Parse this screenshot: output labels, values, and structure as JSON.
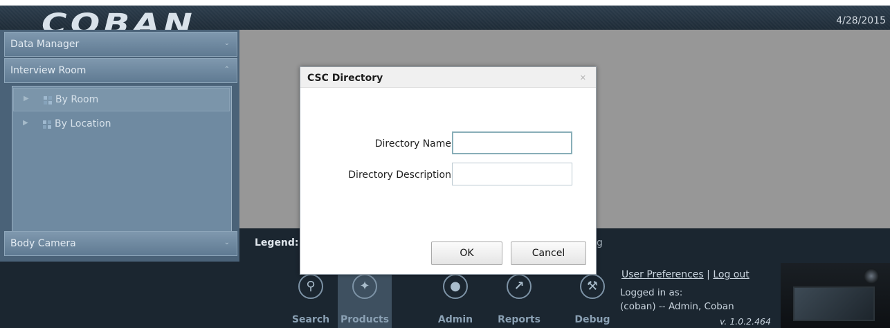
{
  "header": {
    "logo_text": "COBAN",
    "date": "4/28/2015"
  },
  "sidebar": {
    "sections": [
      {
        "label": "Data Manager",
        "state": "collapsed"
      },
      {
        "label": "Interview Room",
        "state": "expanded"
      },
      {
        "label": "Body Camera",
        "state": "collapsed"
      }
    ],
    "tree": [
      {
        "label": "By Room",
        "icon": "room-group-icon",
        "selected": true
      },
      {
        "label": "By Location",
        "icon": "location-group-icon",
        "selected": false
      }
    ]
  },
  "legend": {
    "label": "Legend:",
    "partial_text": "g"
  },
  "nav": {
    "items": [
      {
        "label": "Search",
        "icon": "search-icon"
      },
      {
        "label": "Products",
        "icon": "products-icon",
        "active": true
      },
      {
        "label": "Admin",
        "icon": "admin-icon"
      },
      {
        "label": "Reports",
        "icon": "reports-icon"
      },
      {
        "label": "Debug",
        "icon": "debug-icon"
      }
    ]
  },
  "user": {
    "preferences_link": "User Preferences",
    "separator": "|",
    "logout_link": "Log out",
    "logged_in_label": "Logged in as:",
    "logged_in_user": "(coban) -- Admin, Coban",
    "version": "v. 1.0.2.464"
  },
  "dialog": {
    "title": "CSC Directory",
    "fields": [
      {
        "label": "Directory Name",
        "value": "",
        "focused": true
      },
      {
        "label": "Directory Description",
        "value": "",
        "focused": false
      }
    ],
    "ok_label": "OK",
    "cancel_label": "Cancel"
  },
  "colors": {
    "header_bg": "#1e2b37",
    "sidebar_bg": "#4a6278",
    "content_bg": "#979797",
    "dialog_bg": "#ffffff",
    "input_focus_border": "#88aeb8"
  }
}
